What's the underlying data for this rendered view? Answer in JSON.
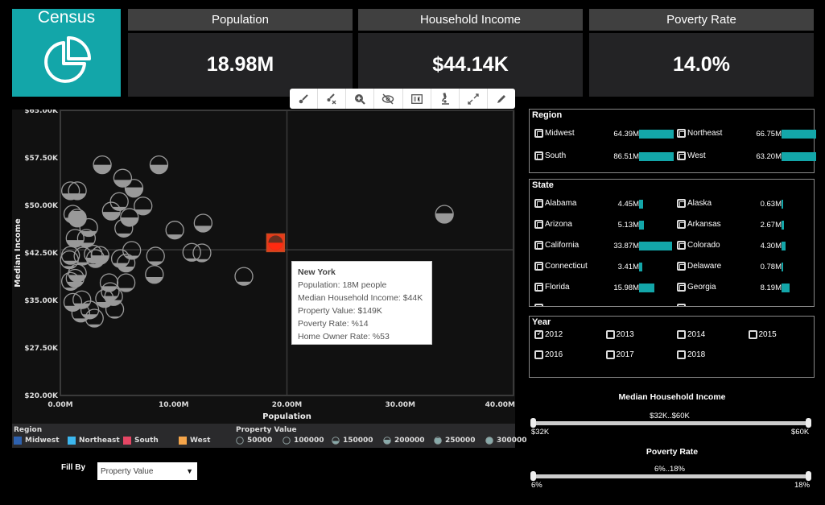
{
  "app": {
    "title": "Census",
    "logo_icon": "pie-chart-icon"
  },
  "kpis": [
    {
      "label": "Population",
      "value": "18.98M"
    },
    {
      "label": "Household Income",
      "value": "$44.14K"
    },
    {
      "label": "Poverty Rate",
      "value": "14.0%"
    }
  ],
  "toolbar": {
    "buttons": [
      {
        "name": "brush",
        "icon": "brush-icon"
      },
      {
        "name": "clear-brush",
        "icon": "clear-brush-icon"
      },
      {
        "name": "zoom",
        "icon": "zoom-in-icon"
      },
      {
        "name": "hide",
        "icon": "eye-slash-icon"
      },
      {
        "name": "show-data",
        "icon": "data-table-icon"
      },
      {
        "name": "analyze",
        "icon": "microscope-icon"
      },
      {
        "name": "expand",
        "icon": "expand-icon"
      },
      {
        "name": "edit",
        "icon": "pencil-icon"
      }
    ]
  },
  "chart_data": {
    "type": "scatter",
    "title": "",
    "xlabel": "Population",
    "ylabel": "Median Income",
    "xlim": [
      0,
      40
    ],
    "ylim": [
      20,
      65
    ],
    "x_unit": "M",
    "y_unit": "K",
    "x_ticks": [
      "0.00M",
      "10.00M",
      "20.00M",
      "30.00M",
      "40.00M"
    ],
    "y_ticks": [
      "$20.00K",
      "$27.50K",
      "$35.00K",
      "$42.50K",
      "$50.00K",
      "$57.50K",
      "$65.00K"
    ],
    "crosshair": {
      "x": 20,
      "y": 43
    },
    "fill_by": "Property Value",
    "points": [
      {
        "x": 3.7,
        "y": 56.4,
        "fill": 0.5
      },
      {
        "x": 8.7,
        "y": 56.4,
        "fill": 0.5
      },
      {
        "x": 5.5,
        "y": 54.3,
        "fill": 0.4
      },
      {
        "x": 6.5,
        "y": 52.7,
        "fill": 0.55
      },
      {
        "x": 0.9,
        "y": 52.3,
        "fill": 0.35
      },
      {
        "x": 1.5,
        "y": 52.3,
        "fill": 0.35
      },
      {
        "x": 5.2,
        "y": 50.6,
        "fill": 0.2
      },
      {
        "x": 7.3,
        "y": 49.9,
        "fill": 0.3
      },
      {
        "x": 1.1,
        "y": 48.6,
        "fill": 0.3
      },
      {
        "x": 1.5,
        "y": 48.0,
        "fill": 0.9
      },
      {
        "x": 4.5,
        "y": 49.1,
        "fill": 0.45
      },
      {
        "x": 6.1,
        "y": 48.1,
        "fill": 0.5
      },
      {
        "x": 5.6,
        "y": 46.4,
        "fill": 0.2
      },
      {
        "x": 10.1,
        "y": 46.1,
        "fill": 0.25
      },
      {
        "x": 12.6,
        "y": 47.2,
        "fill": 0.35
      },
      {
        "x": 2.5,
        "y": 46.5,
        "fill": 0.3
      },
      {
        "x": 1.3,
        "y": 44.8,
        "fill": 0.4
      },
      {
        "x": 2.3,
        "y": 44.8,
        "fill": 0.25
      },
      {
        "x": 6.3,
        "y": 42.9,
        "fill": 0.2
      },
      {
        "x": 8.4,
        "y": 42.0,
        "fill": 0.2
      },
      {
        "x": 11.6,
        "y": 42.6,
        "fill": 0.15
      },
      {
        "x": 12.5,
        "y": 42.5,
        "fill": 0.15
      },
      {
        "x": 0.9,
        "y": 42.1,
        "fill": 0.2
      },
      {
        "x": 0.8,
        "y": 41.4,
        "fill": 0.15
      },
      {
        "x": 2.0,
        "y": 42.0,
        "fill": 0.15
      },
      {
        "x": 2.9,
        "y": 42.3,
        "fill": 0.3
      },
      {
        "x": 3.5,
        "y": 42.1,
        "fill": 0.5
      },
      {
        "x": 3.1,
        "y": 41.6,
        "fill": 0.2
      },
      {
        "x": 5.3,
        "y": 41.6,
        "fill": 0.25
      },
      {
        "x": 5.8,
        "y": 40.9,
        "fill": 0.3
      },
      {
        "x": 1.5,
        "y": 39.3,
        "fill": 0.4
      },
      {
        "x": 1.3,
        "y": 38.5,
        "fill": 0.3
      },
      {
        "x": 0.9,
        "y": 38.0,
        "fill": 0.15
      },
      {
        "x": 4.3,
        "y": 37.8,
        "fill": 0.3
      },
      {
        "x": 5.8,
        "y": 37.8,
        "fill": 0.2
      },
      {
        "x": 4.4,
        "y": 36.4,
        "fill": 0.25
      },
      {
        "x": 3.9,
        "y": 35.3,
        "fill": 0.3
      },
      {
        "x": 4.7,
        "y": 35.6,
        "fill": 0.3
      },
      {
        "x": 1.1,
        "y": 34.7,
        "fill": 0.3
      },
      {
        "x": 1.9,
        "y": 35.1,
        "fill": 0.3
      },
      {
        "x": 2.6,
        "y": 33.5,
        "fill": 0.25
      },
      {
        "x": 1.8,
        "y": 33.0,
        "fill": 0.2
      },
      {
        "x": 3.0,
        "y": 32.2,
        "fill": 0.15
      },
      {
        "x": 4.8,
        "y": 33.6,
        "fill": 0.1
      },
      {
        "x": 8.3,
        "y": 39.1,
        "fill": 0.35
      },
      {
        "x": 16.2,
        "y": 38.8,
        "fill": 0.2
      },
      {
        "x": 33.9,
        "y": 48.6,
        "fill": 0.55
      },
      {
        "x": 19.0,
        "y": 44.1,
        "fill": 0.5,
        "highlight": true,
        "label": "New York"
      }
    ]
  },
  "tooltip": {
    "title": "New York",
    "lines": [
      "Population:  18M people",
      "Median Household Income:  $44K",
      "Property Value:  $149K",
      "Poverty Rate:  %14",
      "Home Owner Rate: %53"
    ]
  },
  "legend": {
    "region_title": "Region",
    "regions": [
      {
        "label": "Midwest",
        "color": "#2e62b0"
      },
      {
        "label": "Northeast",
        "color": "#3cb7ef"
      },
      {
        "label": "South",
        "color": "#e54664"
      },
      {
        "label": "West",
        "color": "#f5a54a"
      }
    ],
    "property_title": "Property Value",
    "property_values": [
      {
        "label": "50000",
        "fill": 0.0
      },
      {
        "label": "100000",
        "fill": 0.15
      },
      {
        "label": "150000",
        "fill": 0.45
      },
      {
        "label": "200000",
        "fill": 0.6
      },
      {
        "label": "250000",
        "fill": 0.8
      },
      {
        "label": "300000",
        "fill": 1.0
      }
    ]
  },
  "fill_by": {
    "label": "Fill By",
    "value": "Property Value"
  },
  "region_filter": {
    "title": "Region",
    "items": [
      {
        "label": "Midwest",
        "value": "64.39M",
        "share": 1.0
      },
      {
        "label": "Northeast",
        "value": "66.75M",
        "share": 1.0
      },
      {
        "label": "South",
        "value": "86.51M",
        "share": 1.0
      },
      {
        "label": "West",
        "value": "63.20M",
        "share": 1.0
      }
    ]
  },
  "state_filter": {
    "title": "State",
    "items": [
      {
        "label": "Alabama",
        "value": "4.45M",
        "share": 0.131
      },
      {
        "label": "Alaska",
        "value": "0.63M",
        "share": 0.019
      },
      {
        "label": "Arizona",
        "value": "5.13M",
        "share": 0.151
      },
      {
        "label": "Arkansas",
        "value": "2.67M",
        "share": 0.079
      },
      {
        "label": "California",
        "value": "33.87M",
        "share": 1.0
      },
      {
        "label": "Colorado",
        "value": "4.30M",
        "share": 0.127
      },
      {
        "label": "Connecticut",
        "value": "3.41M",
        "share": 0.1
      },
      {
        "label": "Delaware",
        "value": "0.78M",
        "share": 0.023
      },
      {
        "label": "Florida",
        "value": "15.98M",
        "share": 0.472
      },
      {
        "label": "Georgia",
        "value": "8.19M",
        "share": 0.242
      }
    ]
  },
  "year_filter": {
    "title": "Year",
    "items": [
      {
        "label": "2012",
        "checked": true
      },
      {
        "label": "2013",
        "checked": false
      },
      {
        "label": "2014",
        "checked": false
      },
      {
        "label": "2015",
        "checked": false
      },
      {
        "label": "2016",
        "checked": false
      },
      {
        "label": "2017",
        "checked": false
      },
      {
        "label": "2018",
        "checked": false
      }
    ]
  },
  "sliders": [
    {
      "title": "Median Household Income",
      "range_text": "$32K..$60K",
      "min_label": "$32K",
      "max_label": "$60K",
      "low": 0.0,
      "high": 1.0
    },
    {
      "title": "Poverty Rate",
      "range_text": "6%..18%",
      "min_label": "6%",
      "max_label": "18%",
      "low": 0.0,
      "high": 1.0
    }
  ],
  "colors": {
    "accent": "#13a6a9",
    "highlight": "#e8391a",
    "bubble": "#999999"
  }
}
